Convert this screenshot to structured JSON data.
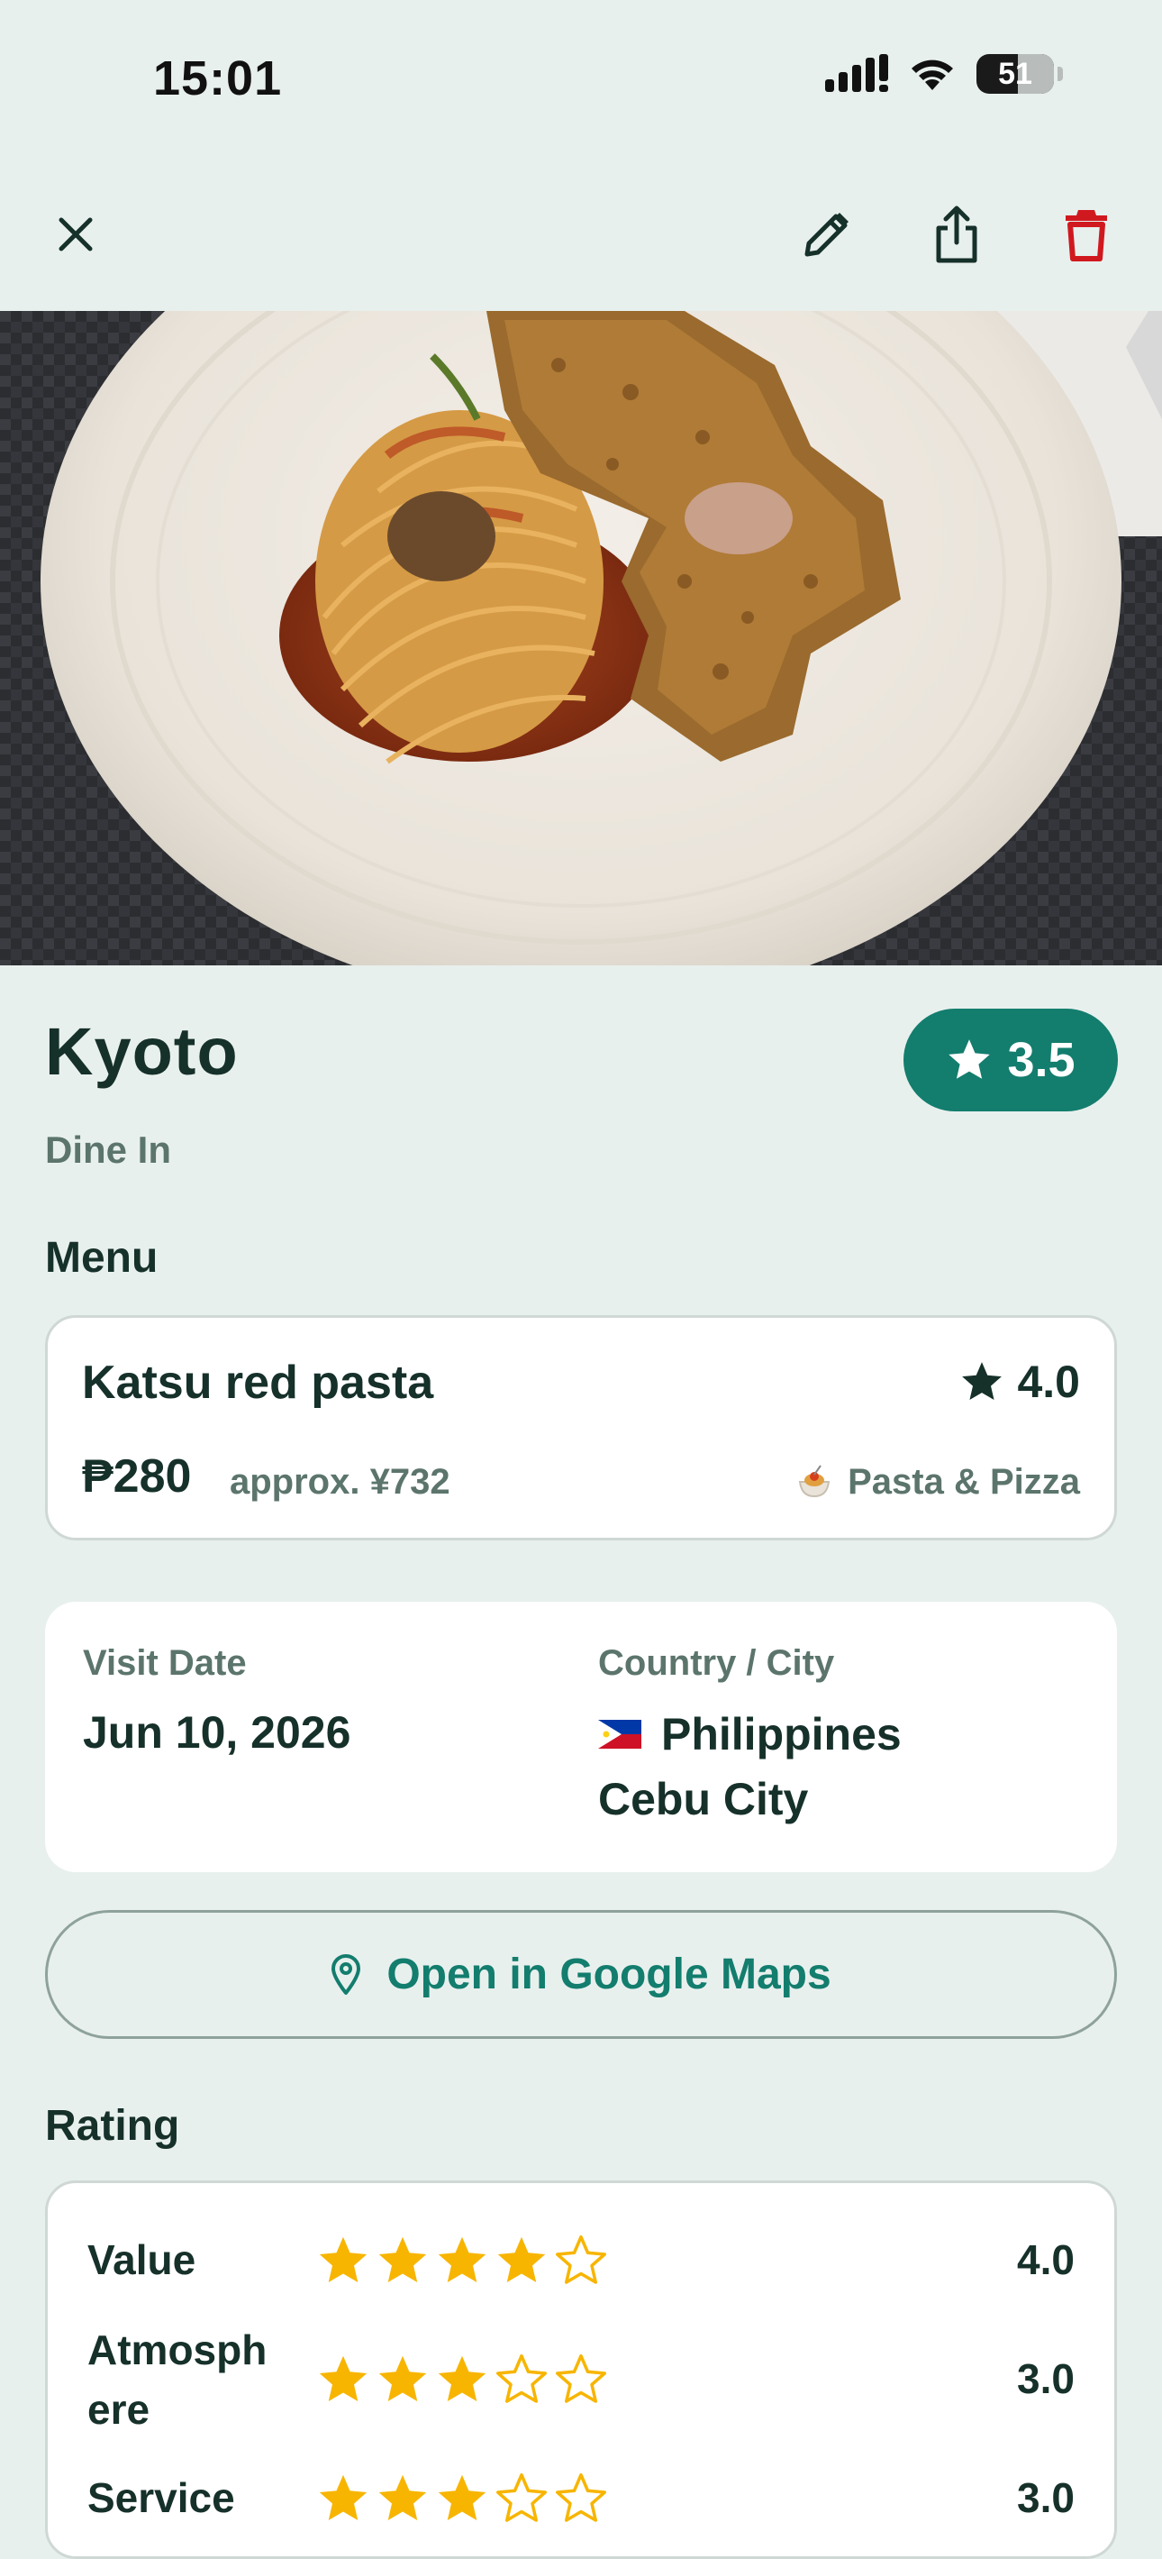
{
  "status_bar": {
    "time": "15:01",
    "battery": "51"
  },
  "header": {
    "title": "Kyoto",
    "rating": "3.5",
    "dining_type": "Dine In"
  },
  "menu": {
    "section_title": "Menu",
    "item_name": "Katsu red pasta",
    "item_rating": "4.0",
    "price": "₱280",
    "approx_price": "approx. ¥732",
    "category": "Pasta & Pizza"
  },
  "visit": {
    "date_label": "Visit Date",
    "date_value": "Jun 10, 2026",
    "location_label": "Country / City",
    "country": "Philippines",
    "city": "Cebu City"
  },
  "maps_button": {
    "label": "Open in Google Maps"
  },
  "rating": {
    "section_title": "Rating",
    "rows": [
      {
        "label": "Value",
        "value": "4.0",
        "stars": 4
      },
      {
        "label": "Atmosph\nere",
        "value": "3.0",
        "stars": 3
      },
      {
        "label": "Service",
        "value": "3.0",
        "stars": 3
      }
    ]
  },
  "colors": {
    "accent": "#137d6e",
    "star": "#f7b500",
    "delete": "#d0191f",
    "background": "#e8f0ed"
  },
  "icons": [
    "close-icon",
    "edit-icon",
    "share-icon",
    "trash-icon",
    "star-icon",
    "map-pin-icon",
    "philippines-flag-icon",
    "pasta-icon"
  ]
}
